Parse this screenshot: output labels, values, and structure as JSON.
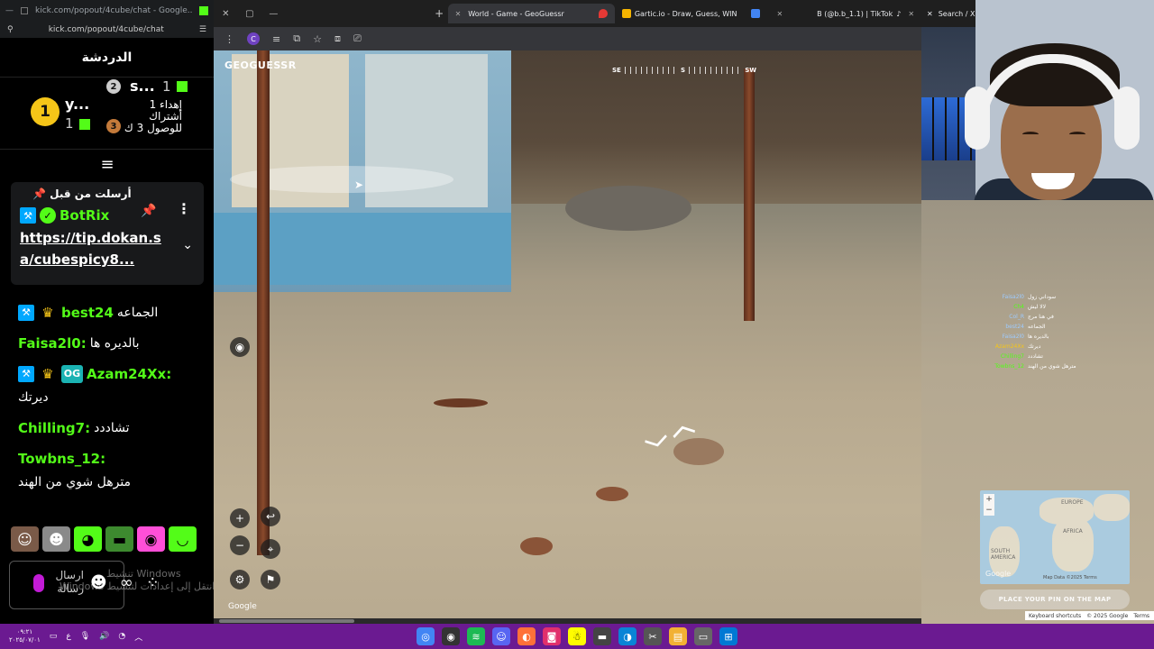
{
  "chat_window": {
    "tab_title": "kick.com/popout/4cube/chat - Google...",
    "url": "kick.com/popout/4cube/chat",
    "header": "الدردشة",
    "leaderboard": {
      "first": {
        "rank": "1",
        "name": "y...",
        "count": "1"
      },
      "second": {
        "rank": "2",
        "name": "s...",
        "count": "1"
      },
      "third": {
        "rank": "3",
        "message": "إهداء 1 أشتراك للوصول 3 ك"
      }
    },
    "pinned": {
      "header": "أرسلت من قبل",
      "user": "BotRix",
      "link": "https://tip.dokan.sa/cubespicy8..."
    },
    "messages": [
      {
        "user": "best24",
        "text": "الجماعه",
        "badges": [
          "mod",
          "sub"
        ]
      },
      {
        "user": "Faisa2l0:",
        "text": "بالديره ها",
        "badges": []
      },
      {
        "user": "Azam24Xx:",
        "text": "ديرتك",
        "badges": [
          "mod",
          "sub",
          "og"
        ]
      },
      {
        "user": "Chilling7:",
        "text": "تشاددد",
        "badges": []
      },
      {
        "user": "Towbns_12:",
        "text": "مترهل شوي من الهند",
        "badges": []
      }
    ],
    "input_placeholder": "ارسال رسالة",
    "windows_watermark_line1": "تنشيط Windows",
    "windows_watermark_line2": "Windows انتقل إلى إعدادات لتنشيط"
  },
  "browser": {
    "tabs": [
      {
        "label": "World - Game - GeoGuessr",
        "active": true,
        "favicon_color": "#ffffff"
      },
      {
        "label": "Gartic.io - Draw, Guess, WIN",
        "active": false,
        "favicon_color": "#e53935"
      },
      {
        "label": "",
        "active": false,
        "favicon_color": "#4285f4"
      },
      {
        "label": "B (@b.b_1.1) | TikTok",
        "active": false,
        "favicon_color": "#000000"
      },
      {
        "label": "Search / X",
        "active": false,
        "favicon_color": "#1d1d1d"
      }
    ],
    "toolbar_right_letter": "G"
  },
  "geoguessr": {
    "logo_text": "GEOGUESSR",
    "compass": {
      "left": "SE",
      "center": "S",
      "right": "SW"
    },
    "google_label": "Google",
    "place_pin_label": "PLACE YOUR PIN ON THE MAP",
    "map": {
      "labels": {
        "europe": "EUROPE",
        "africa": "AFRICA",
        "south_america": "SOUTH AMERICA"
      },
      "zoom_in": "+",
      "zoom_out": "−",
      "attribution": "Map Data ©2025   Terms",
      "google": "Google"
    },
    "map_footer": {
      "shortcuts": "Keyboard shortcuts",
      "data": "© 2025 Google",
      "terms": "Terms"
    },
    "overlay_chat": [
      {
        "name": "Faisa2l0",
        "text": "سوداني زول"
      },
      {
        "name": "Ch4",
        "text": "لالا ليش"
      },
      {
        "name": "Col_R",
        "text": "في هنا مرج"
      },
      {
        "name": "best24",
        "text": "الجماعه"
      },
      {
        "name": "Faisa2l0",
        "text": "بالديره ها"
      },
      {
        "name": "Azam24Xx",
        "text": "ديرتك"
      },
      {
        "name": "Chilling7",
        "text": "تشاددد"
      },
      {
        "name": "Towbns_12",
        "text": "مترهل شوي من الهند"
      }
    ]
  },
  "taskbar": {
    "clock_time": "٠٩:٢١",
    "clock_date": "٢٠٢٥/٠٧/٠١",
    "lang": "ع"
  }
}
